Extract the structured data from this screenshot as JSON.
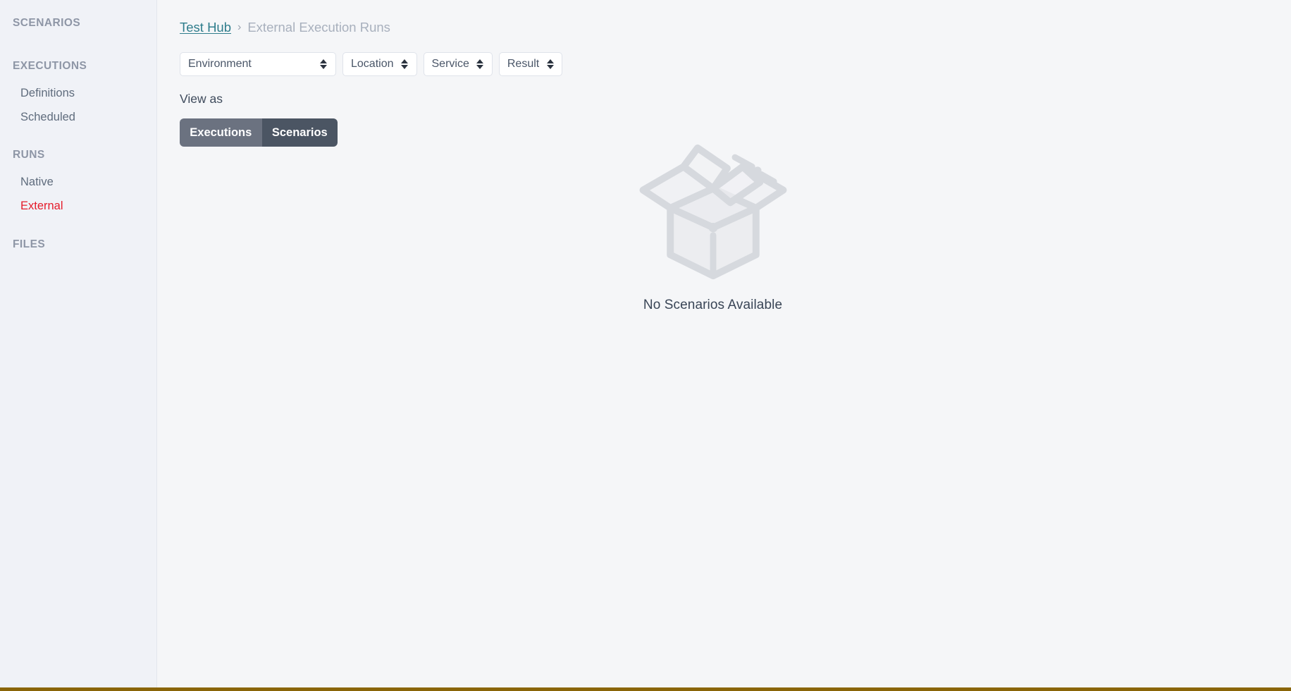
{
  "sidebar": {
    "groups": [
      {
        "header": "SCENARIOS",
        "items": []
      },
      {
        "header": "EXECUTIONS",
        "items": [
          {
            "label": "Definitions",
            "active": false
          },
          {
            "label": "Scheduled",
            "active": false
          }
        ]
      },
      {
        "header": "RUNS",
        "items": [
          {
            "label": "Native",
            "active": false
          },
          {
            "label": "External",
            "active": true
          }
        ]
      },
      {
        "header": "FILES",
        "items": []
      }
    ],
    "active_color": "#e51c2b"
  },
  "breadcrumb": {
    "root_label": "Test Hub",
    "separator": "›",
    "current_label": "External Execution Runs",
    "link_color": "#2f7d8c"
  },
  "filters": [
    {
      "label": "Environment",
      "icon": "select-arrows-icon",
      "wide": true
    },
    {
      "label": "Location",
      "icon": "select-arrows-icon",
      "wide": false
    },
    {
      "label": "Service",
      "icon": "select-arrows-icon",
      "wide": false
    },
    {
      "label": "Result",
      "icon": "select-arrows-icon",
      "wide": false
    }
  ],
  "view_as": {
    "label": "View as",
    "options": [
      {
        "label": "Executions",
        "selected": false
      },
      {
        "label": "Scenarios",
        "selected": true
      }
    ],
    "inactive_color": "#6b7280",
    "active_color": "#4b5563"
  },
  "empty_state": {
    "icon": "empty-box-icon",
    "message": "No Scenarios Available",
    "illustration_color": "#d6d9de"
  },
  "theme": {
    "page_background": "#f5f6f8",
    "sidebar_background": "#f0f2f7",
    "bottom_border_color": "#8a6508"
  }
}
